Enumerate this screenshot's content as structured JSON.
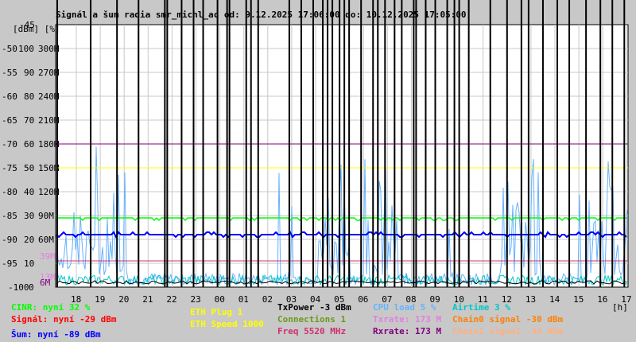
{
  "chart_data": {
    "type": "line",
    "title": "Signál a šum radia smr_michl_ac od: 9.12.2025 17:06:00 do: 10.12.2025 17:05:00",
    "y_unit_labels": "[dBm] [%]",
    "x_unit_label": "[h]",
    "ylim_dbm": [
      -100,
      -45
    ],
    "y_ticks_dbm": [
      "-45",
      "-50",
      "-55",
      "-60",
      "-65",
      "-70",
      "-75",
      "-80",
      "-85",
      "-90",
      "-95",
      "-100"
    ],
    "y_ticks_pct": [
      "",
      "100",
      "90",
      "80",
      "70",
      "60",
      "50",
      "40",
      "30",
      "20",
      "10",
      "0"
    ],
    "y_ticks_rate": [
      "",
      "300M",
      "270M",
      "240M",
      "210M",
      "180M",
      "150M",
      "120M",
      "90M",
      "60M",
      "",
      ""
    ],
    "extra_rate_marks": [
      {
        "label": "39M",
        "value": 39,
        "color": "#e080e0"
      },
      {
        "label": "13M",
        "value": 13,
        "color": "#e080e0"
      },
      {
        "label": "6M",
        "value": 6,
        "color": "#800080"
      }
    ],
    "x_ticks": [
      "18",
      "19",
      "20",
      "21",
      "22",
      "23",
      "00",
      "01",
      "02",
      "03",
      "04",
      "05",
      "06",
      "07",
      "08",
      "09",
      "10",
      "11",
      "12",
      "13",
      "14",
      "15",
      "16",
      "17"
    ],
    "outage_hours": [
      -0.8,
      0.6,
      1.7,
      2.6,
      3.7,
      3.8,
      4.4,
      4.9,
      5.3,
      5.9,
      6.3,
      6.4,
      7.1,
      7.3,
      7.6,
      8.9,
      9.4,
      9.9,
      10.3,
      10.5,
      10.7,
      11.0,
      11.2,
      11.4,
      11.9,
      12.4,
      12.6,
      12.9,
      13.3,
      13.6,
      14.1,
      14.2,
      14.6,
      15.0,
      15.5,
      15.8,
      16.0,
      16.4,
      17.3,
      18.0,
      18.6,
      18.9,
      19.5,
      20.1,
      20.6,
      21.3,
      21.9,
      22.4,
      22.9
    ],
    "series": [
      {
        "name": "CINR",
        "now": "32 %",
        "level_dbm": -85.5,
        "color": "#00ff00"
      },
      {
        "name": "Signál",
        "now": "-29 dBm",
        "color": "#ff0000"
      },
      {
        "name": "Šum",
        "now": "-89 dBm",
        "level_dbm": -89,
        "color": "#0000ff"
      },
      {
        "name": "ETH Plug",
        "now": "1",
        "color": "#ffff00"
      },
      {
        "name": "ETH Speed",
        "now": "1000",
        "level_dbm": -75,
        "color": "#ffff00"
      },
      {
        "name": "TxPower",
        "now": "-3 dBm",
        "color": "#000000"
      },
      {
        "name": "Connections",
        "now": "1",
        "color": "#6b9a1a"
      },
      {
        "name": "Freq",
        "now": "5520 MHz",
        "level_dbm": -94.5,
        "color": "#d03070"
      },
      {
        "name": "CPU load",
        "now": "5 %",
        "color": "#66b2ff"
      },
      {
        "name": "Txrate",
        "now": "173 M",
        "color": "#e080e0"
      },
      {
        "name": "Rxrate",
        "now": "173 M",
        "level_dbm": -70,
        "color": "#800080"
      },
      {
        "name": "Airtime",
        "now": "3 %",
        "color": "#00c8c8"
      },
      {
        "name": "Chain0 signal",
        "now": "-30 dBm",
        "color": "#ff8000"
      },
      {
        "name": "Chain1 signal",
        "now": "-34 dBm",
        "color": "#ffb080"
      }
    ]
  },
  "legend": {
    "cinr": "CINR: nyní 32 %",
    "signal": "Signál: nyní -29 dBm",
    "noise": "Šum: nyní -89 dBm",
    "eth_plug": "ETH Plug 1",
    "eth_speed": "ETH Speed 1000",
    "txpower": "TxPower -3 dBm",
    "connections": "Connections 1",
    "freq": "Freq 5520 MHz",
    "cpu": "CPU load 5 %",
    "txrate": "Txrate: 173 M",
    "rxrate": "Rxrate: 173 M",
    "airtime": "Airtime 3 %",
    "chain0": "Chain0 signal -30 dBm",
    "chain1": "Chain1 signal -34 dBm"
  }
}
